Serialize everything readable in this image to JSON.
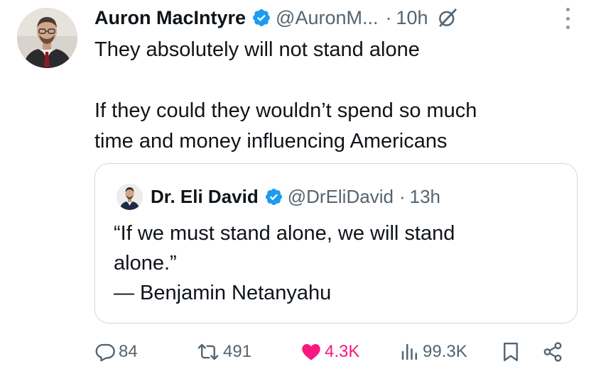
{
  "tweet": {
    "author_name": "Auron MacIntyre",
    "handle": "@AuronM...",
    "separator": "·",
    "time": "10h",
    "text": "They absolutely will not stand alone\n\nIf they could they wouldn’t spend so much\ntime and money influencing Americans"
  },
  "quote": {
    "author_name": "Dr. Eli David",
    "handle": "@DrEliDavid",
    "separator": "·",
    "time": "13h",
    "text": "“If we must stand alone, we will stand\nalone.”\n— Benjamin Netanyahu"
  },
  "actions": {
    "replies": "84",
    "reposts": "491",
    "likes": "4.3K",
    "views": "99.3K"
  },
  "icons": {
    "verified": "verified-badge-icon",
    "grok": "grok-icon",
    "more": "more-dots-icon",
    "reply": "reply-icon",
    "repost": "repost-icon",
    "like": "heart-icon",
    "views": "views-chart-icon",
    "bookmark": "bookmark-icon",
    "share": "share-icon"
  },
  "colors": {
    "verified_blue": "#1d9bf0",
    "like_pink": "#f91880",
    "secondary_text": "#536471",
    "border": "#cfd9de"
  }
}
